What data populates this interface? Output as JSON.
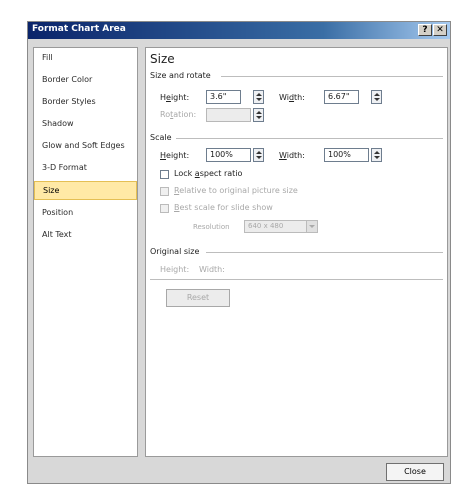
{
  "window": {
    "title": "Format Chart Area",
    "help_glyph": "?",
    "close_glyph": "✕"
  },
  "nav": {
    "items": [
      {
        "label": "Fill"
      },
      {
        "label": "Border Color"
      },
      {
        "label": "Border Styles"
      },
      {
        "label": "Shadow"
      },
      {
        "label": "Glow and Soft Edges"
      },
      {
        "label": "3-D Format"
      },
      {
        "label": "Size"
      },
      {
        "label": "Position"
      },
      {
        "label": "Alt Text"
      }
    ],
    "selected": "Size"
  },
  "panel": {
    "heading": "Size",
    "size_and_rotate": {
      "section_label": "Size and rotate",
      "height_label_pre": "H",
      "height_label_key": "e",
      "height_label_post": "ight:",
      "height_value": "3.6\"",
      "width_label_pre": "Wi",
      "width_label_key": "d",
      "width_label_post": "th:",
      "width_value": "6.67\"",
      "rotation_label_pre": "Ro",
      "rotation_label_key": "t",
      "rotation_label_post": "ation:",
      "rotation_value": ""
    },
    "scale": {
      "section_label": "Scale",
      "height_label_pre": "",
      "height_label_key": "H",
      "height_label_post": "eight:",
      "height_value": "100%",
      "width_label_pre": "",
      "width_label_key": "W",
      "width_label_post": "idth:",
      "width_value": "100%",
      "lock_pre": "Lock ",
      "lock_key": "a",
      "lock_post": "spect ratio",
      "lock_checked": false,
      "relative_pre": "",
      "relative_key": "R",
      "relative_post": "elative to original picture size",
      "best_pre": "",
      "best_key": "B",
      "best_post": "est scale for slide show",
      "resolution_label": "Resolution",
      "resolution_value": "640 x 480"
    },
    "original_size": {
      "section_label": "Original size",
      "height_text": "Height:",
      "width_text": "Width:"
    },
    "reset_label": "Reset"
  },
  "footer": {
    "close_label": "Close"
  }
}
